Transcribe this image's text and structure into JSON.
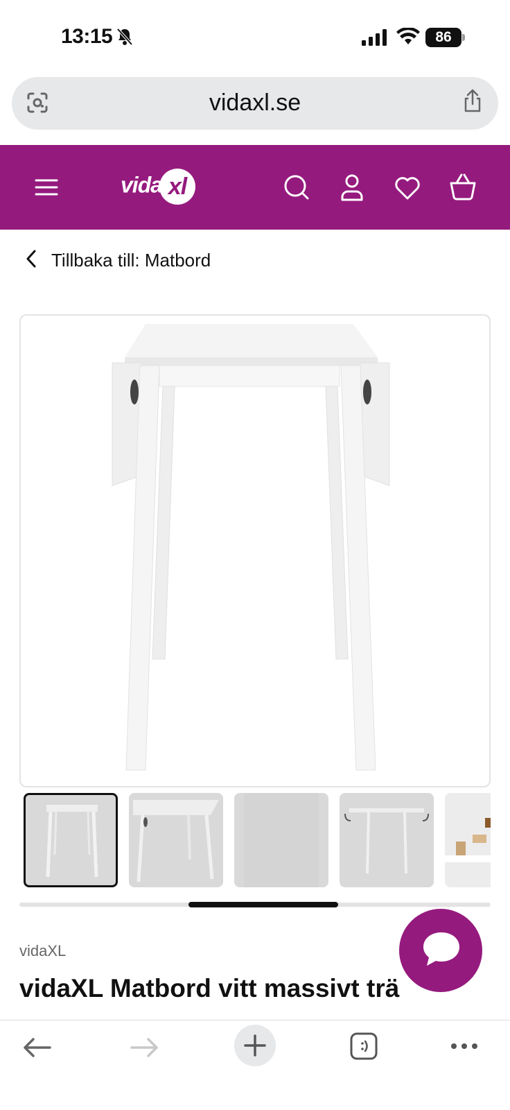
{
  "status": {
    "time": "13:15",
    "battery": "86"
  },
  "browser": {
    "url": "vidaxl.se"
  },
  "header": {
    "logo_text": "vida",
    "logo_xl": "xl"
  },
  "nav": {
    "back_label": "Tillbaka till: Matbord"
  },
  "product": {
    "brand": "vidaXL",
    "title": "vidaXL Matbord vitt massivt trä"
  },
  "colors": {
    "brand": "#951a7e",
    "url_bg": "#e6e8ea"
  },
  "icons": [
    "camera-lens-icon",
    "share-icon",
    "menu-icon",
    "search-icon",
    "account-icon",
    "heart-icon",
    "basket-icon",
    "chevron-left-icon",
    "chat-icon",
    "back-arrow-icon",
    "forward-arrow-icon",
    "plus-icon",
    "tabs-icon",
    "more-icon"
  ]
}
